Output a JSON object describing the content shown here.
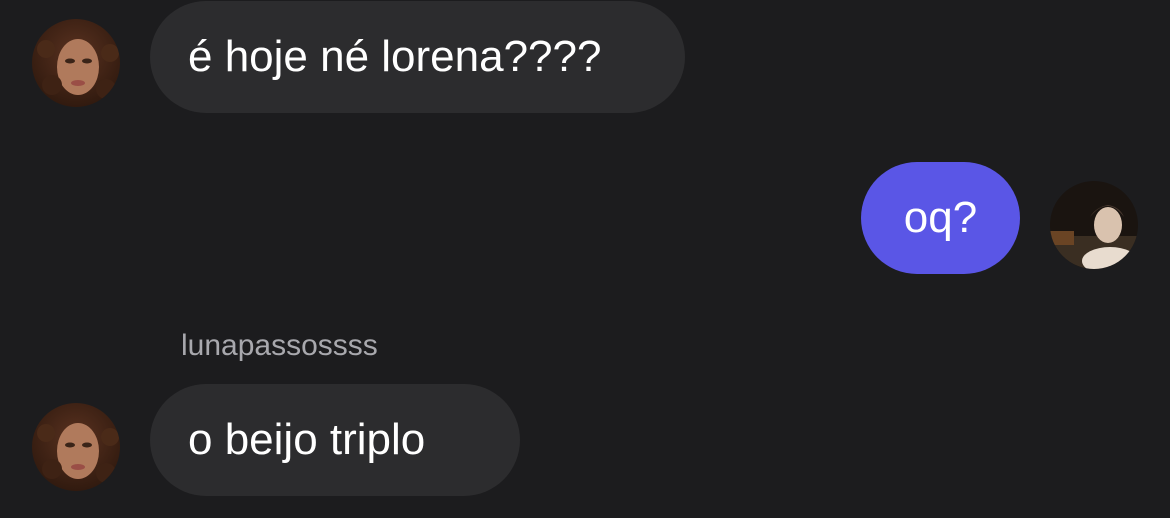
{
  "colors": {
    "background": "#1c1c1e",
    "incoming_bubble": "#2c2c2e",
    "outgoing_bubble": "#5a56e6",
    "sender_name": "#a8a8ad",
    "text": "#ffffff"
  },
  "messages": [
    {
      "direction": "incoming",
      "avatar": "contact-avatar",
      "text": "é hoje né lorena????"
    },
    {
      "direction": "outgoing",
      "avatar": "user-avatar",
      "text": "oq?"
    },
    {
      "direction": "incoming",
      "sender": "lunapassossss",
      "avatar": "contact-avatar",
      "text": "o beijo triplo"
    }
  ]
}
